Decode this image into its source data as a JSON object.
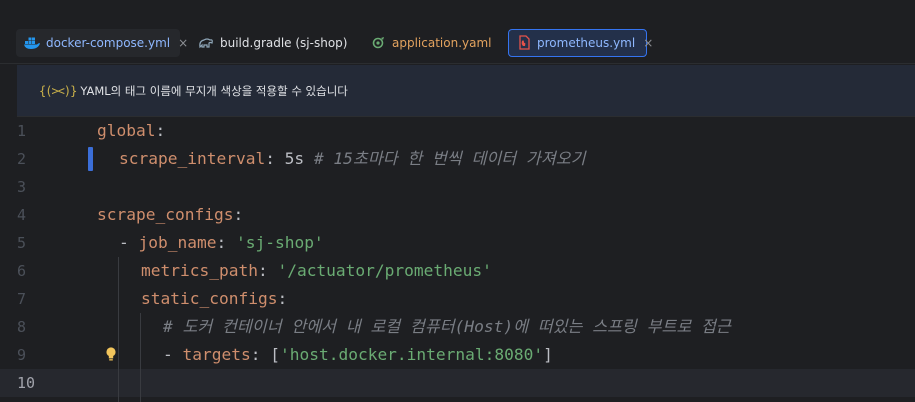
{
  "tabs": [
    {
      "label": "docker-compose.yml",
      "icon": "docker-icon",
      "has_close": true,
      "close": "×"
    },
    {
      "label": "build.gradle (sj-shop)",
      "icon": "gradle-elephant-icon",
      "has_close": false
    },
    {
      "label": "application.yaml",
      "icon": "spring-config-icon",
      "has_close": false
    },
    {
      "label": "prometheus.yml",
      "icon": "prometheus-file-icon",
      "has_close": true,
      "close": "×",
      "active": true
    }
  ],
  "banner": {
    "icon_text": "{(><)}",
    "text": "YAML의 태그 이름에 무지개 색상을 적용할 수 있습니다"
  },
  "editor": {
    "current_line": 10,
    "line_numbers": [
      "1",
      "2",
      "3",
      "4",
      "5",
      "6",
      "7",
      "8",
      "9",
      "10"
    ],
    "lines": {
      "l1": {
        "key": "global",
        "colon": ":"
      },
      "l2": {
        "key": "scrape_interval",
        "colon": ":",
        "value": " 5s",
        "comment": "# 15초마다 한 번씩 데이터 가져오기"
      },
      "l4": {
        "key": "scrape_configs",
        "colon": ":"
      },
      "l5": {
        "dash": "- ",
        "key": "job_name",
        "colon": ":",
        "value": "'sj-shop'"
      },
      "l6": {
        "key": "metrics_path",
        "colon": ":",
        "value": "'/actuator/prometheus'"
      },
      "l7": {
        "key": "static_configs",
        "colon": ":"
      },
      "l8": {
        "comment": "# 도커 컨테이너 안에서 내 로컬 컴퓨터(Host)에 떠있는 스프링 부트로 접근"
      },
      "l9": {
        "dash": "- ",
        "key": "targets",
        "colon": ":",
        "open": " [",
        "value": "'host.docker.internal:8080'",
        "close": "]"
      }
    }
  },
  "colors": {
    "background": "#1e1f22",
    "key": "#cf8e6d",
    "string": "#6aab73",
    "comment": "#7a7e85",
    "accent": "#3574f0"
  }
}
